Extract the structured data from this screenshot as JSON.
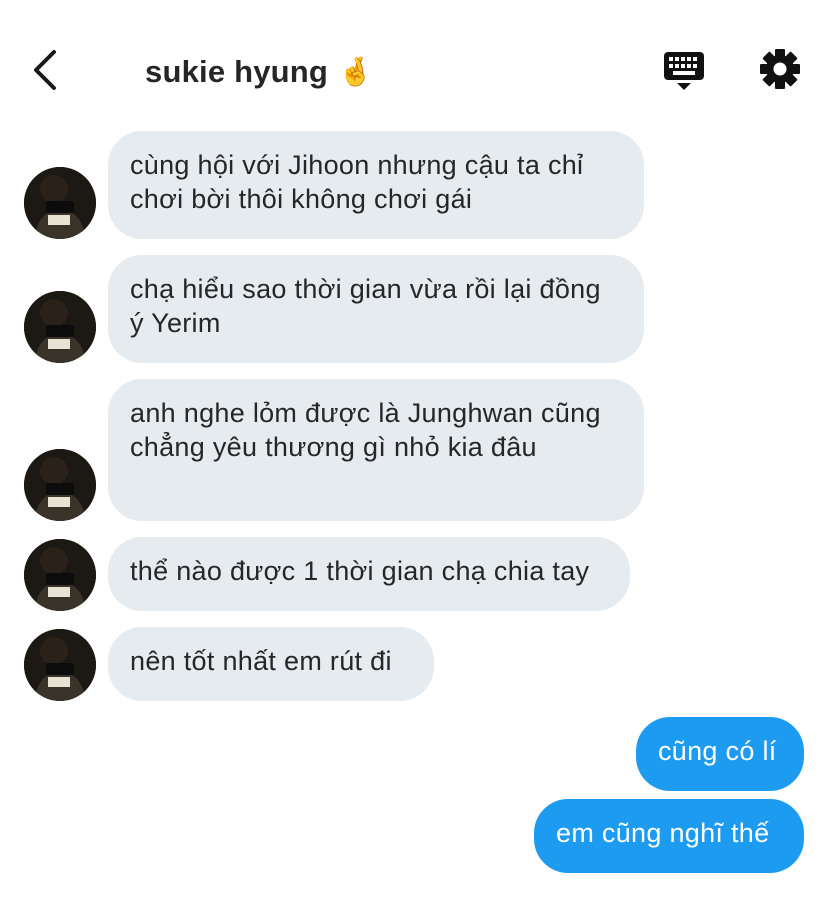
{
  "header": {
    "title": "sukie hyung",
    "title_emoji": "🤞",
    "back_icon": "chevron-left-icon",
    "keyboard_icon": "keyboard-icon",
    "settings_icon": "gear-icon"
  },
  "messages_incoming": [
    {
      "text": "cùng hội với Jihoon nhưng cậu ta chỉ chơi bời thôi không chơi gái"
    },
    {
      "text": "chạ hiểu sao thời gian vừa rồi lại đồng ý Yerim"
    },
    {
      "text": "anh nghe lỏm được là Junghwan cũng chẳng yêu thương gì nhỏ kia đâu"
    },
    {
      "text": "thể nào được 1 thời gian chạ chia tay"
    },
    {
      "text": "nên tốt nhất em rút đi"
    }
  ],
  "messages_outgoing": [
    {
      "text": "cũng có lí"
    },
    {
      "text": "em cũng nghĩ thế"
    }
  ],
  "colors": {
    "incoming_bubble": "#e6ebef",
    "outgoing_bubble": "#1d9bf0",
    "text_dark": "#262626"
  }
}
